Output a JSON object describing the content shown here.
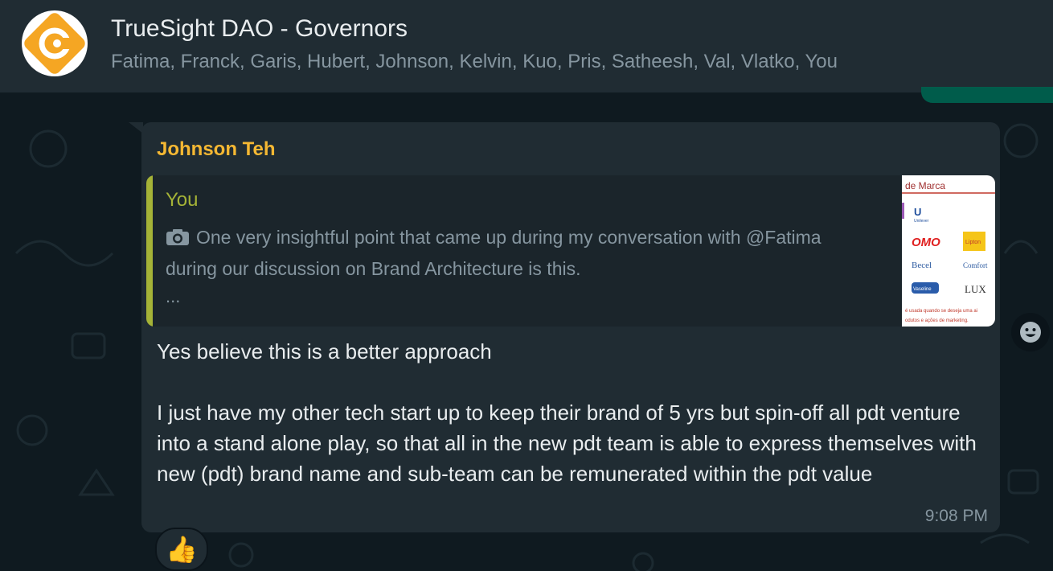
{
  "chat": {
    "title": "TrueSight DAO - Governors",
    "members": "Fatima, Franck, Garis, Hubert, Johnson, Kelvin, Kuo, Pris, Satheesh, Val, Vlatko, You"
  },
  "message": {
    "sender": "Johnson Teh",
    "quoted": {
      "author": "You",
      "text": "One very insightful point that came up during my conversation with @Fatima during our discussion on Brand Architecture is this.",
      "ellipsis": "...",
      "thumbnail": {
        "heading": "de Marca",
        "brands": [
          "Unilever",
          "OMO",
          "Lipton",
          "Becel",
          "Comfort",
          "Vaseline",
          "LUX"
        ],
        "caption_line1": "é usada quando se deseja uma ai",
        "caption_line2": "odutos e ações de marketing."
      }
    },
    "body": "Yes believe this is a better approach\n\nI just have my other tech start up to keep their brand of 5 yrs but spin-off all pdt venture into a stand alone play, so that all in the new pdt team is able to express themselves with new (pdt) brand name and sub-team can be remunerated within the pdt value",
    "time": "9:08 PM",
    "reaction": "👍"
  },
  "icons": {
    "avatar": "truesight-logo",
    "quote_media": "camera-icon",
    "react": "smiley-icon"
  },
  "colors": {
    "header_bg": "#202c33",
    "bubble_bg": "#202c33",
    "sender_name": "#f5b833",
    "quote_accent": "#a5b337",
    "outgoing_bubble": "#005c4b",
    "logo_orange": "#f5a623"
  }
}
